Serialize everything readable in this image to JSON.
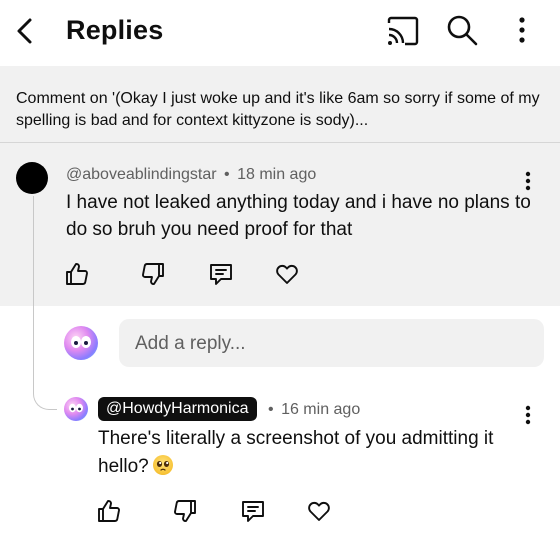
{
  "header": {
    "title": "Replies",
    "icons": [
      "back-arrow-icon",
      "cast-icon",
      "search-icon",
      "more-vert-icon"
    ]
  },
  "parent_comment": {
    "label": "Comment on '(Okay I just woke up and it's like 6am so sorry if some of my spelling is bad and for context kittyzone is sody)..."
  },
  "comment": {
    "author": "@aboveablindingstar",
    "separator": "•",
    "time": "18 min ago",
    "text": "I have not leaked anything today and i have no plans to do so bruh you need proof for that"
  },
  "reply_input": {
    "placeholder": "Add a reply..."
  },
  "reply": {
    "author": "@HowdyHarmonica",
    "separator": "•",
    "time": "16 min ago",
    "text": "There's literally a screenshot of you admitting it hello?",
    "emoji": "pleading-face-emoji"
  },
  "colors": {
    "gray_background": "#f1f1f1",
    "text": "#0f0f0f",
    "secondary_text": "#606060",
    "handle_background": "#0f0f0f"
  }
}
